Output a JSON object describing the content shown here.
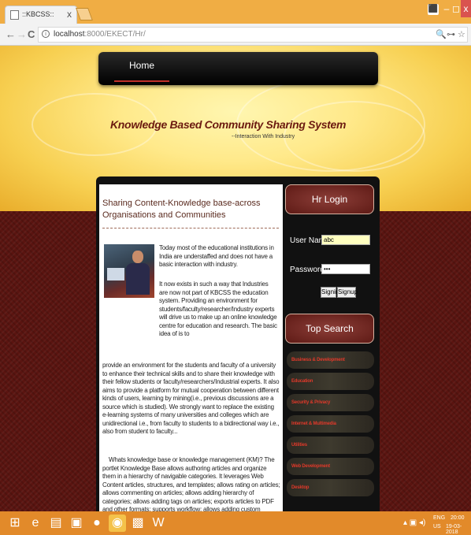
{
  "browser": {
    "tab_title": "::KBCSS::",
    "tab_close": "x",
    "url_host": "localhost",
    "url_path": ":8000/EKECT/Hr/",
    "user_glyph": "⬛",
    "min_glyph": "–",
    "max_glyph": "◻",
    "close_glyph": "x",
    "nav_back": "←",
    "nav_forward": "→",
    "nav_reload": "C",
    "info_glyph": "i",
    "zoom_glyph": "🔍",
    "key_glyph": "⊶",
    "star_glyph": "☆"
  },
  "header": {
    "menu_home": "Home",
    "site_title": "Knowledge Based Community Sharing System",
    "tagline": "--Interaction With Industry"
  },
  "content": {
    "heading": "Sharing Content-Knowledge base-across Organisations and Communities",
    "p1": "Today most of the educational institutions in India are understaffed and does not have a basic interaction with industry.",
    "p2": "It now exists in such a way that Industries are now not part of KBCSS the education system. Providing an environment for students/faculty/researcher/Industry experts will drive us to make up an online knowledge centre for education and research. The basic idea of is to",
    "p3": "provide an environment for the students and faculty of a university to enhance their technical skills and to share their knowledge with their fellow students or faculty/researchers/Industrial experts. It also aims to provide a platform for mutual cooperation between different kinds of users, learning by mining(i.e., previous discussions are a source which is studied). We strongly want to replace the existing e-learning systems of many universities and colleges which are unidirectional i.e., from faculty to students to a bidirectional way i.e., also from student to faculty...",
    "p4": "Whats knowledge base or knowledge management (KM)? The portlet Knowledge Base allows authoring articles and organize them in a hierarchy of navigable categories. It leverages Web Content articles, structures, and templates; allows rating on articles; allows commenting on articles; allows adding hierarchy of categories; allows adding tags on articles; exports articles to PDF and other formats; supports workflow; allows adding custom attributes (called custom fields); supports indexing and advanced search; allows using rule engine; etc."
  },
  "login": {
    "title": "Hr Login",
    "username_label": "User Name",
    "username_value": "abc",
    "password_label": "Password",
    "password_value": "•••",
    "signin": "Signin",
    "signup": "Signup"
  },
  "search": {
    "title": "Top Search",
    "categories": [
      "Business & Development",
      "Education",
      "Security & Privacy",
      "Internet & Multimedia",
      "Utilities",
      "Web Development",
      "Desktop"
    ]
  },
  "taskbar": {
    "lang": "ENG",
    "region": "US",
    "time": "20:00",
    "date": "19-03-2018"
  }
}
